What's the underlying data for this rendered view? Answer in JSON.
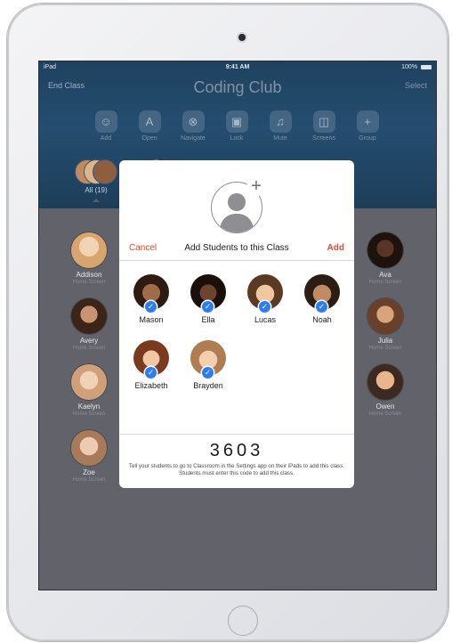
{
  "status_bar": {
    "device": "iPad",
    "time": "9:41 AM",
    "battery": "100%"
  },
  "nav": {
    "left": "End Class",
    "title": "Coding Club",
    "right": "Select"
  },
  "toolbar": [
    {
      "label": "Add",
      "icon": "person-circle-icon",
      "glyph": "☺"
    },
    {
      "label": "Open",
      "icon": "app-store-icon",
      "glyph": "A"
    },
    {
      "label": "Navigate",
      "icon": "compass-icon",
      "glyph": "⊗"
    },
    {
      "label": "Lock",
      "icon": "lock-icon",
      "glyph": "▣"
    },
    {
      "label": "Mute",
      "icon": "mute-icon",
      "glyph": "♫"
    },
    {
      "label": "Screens",
      "icon": "screens-icon",
      "glyph": "◫"
    },
    {
      "label": "Group",
      "icon": "plus-icon",
      "glyph": "+"
    }
  ],
  "group_all": {
    "label": "All (19)"
  },
  "students_left": [
    {
      "name": "Addison",
      "status": "Home Screen",
      "color": "#d9a56f"
    },
    {
      "name": "Avery",
      "status": "Home Screen",
      "color": "#8c5a3c"
    },
    {
      "name": "Kaelyn",
      "status": "Home Screen",
      "color": "#e0b890"
    },
    {
      "name": "Zoe",
      "status": "Home Screen",
      "color": "#c9a184"
    }
  ],
  "students_right": [
    {
      "name": "Ava",
      "status": "Home Screen",
      "color": "#3a2418"
    },
    {
      "name": "Julia",
      "status": "Home Screen",
      "color": "#8a5a3a"
    },
    {
      "name": "Owen",
      "status": "Home Screen",
      "color": "#c98e5e"
    }
  ],
  "modal": {
    "cancel": "Cancel",
    "title": "Add Students to this Class",
    "add": "Add",
    "students": [
      {
        "name": "Mason",
        "color": "#4a3022"
      },
      {
        "name": "Ella",
        "color": "#2b1a14"
      },
      {
        "name": "Lucas",
        "color": "#6b4a2e"
      },
      {
        "name": "Noah",
        "color": "#4d3526"
      },
      {
        "name": "Elizabeth",
        "color": "#7a3a1f"
      },
      {
        "name": "Brayden",
        "color": "#b07c52"
      }
    ],
    "code": "3603",
    "instructions": "Tell your students to go to Classroom in the Settings app on their iPads to add this class. Students must enter this code to add this class."
  }
}
